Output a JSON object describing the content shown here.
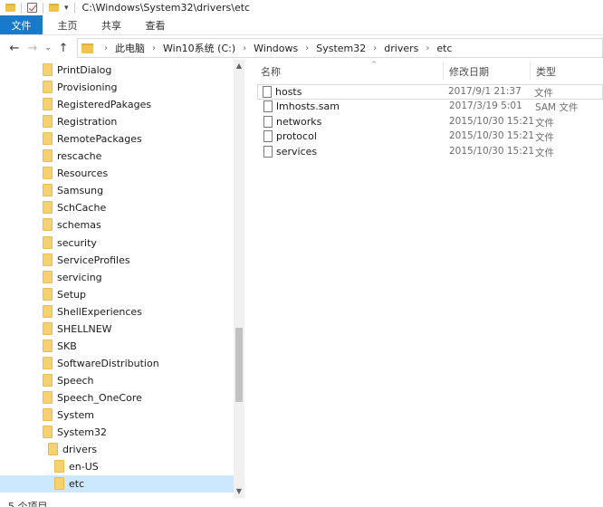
{
  "titlebar": {
    "path": "C:\\Windows\\System32\\drivers\\etc"
  },
  "ribbon": {
    "tabs": [
      "文件",
      "主页",
      "共享",
      "查看"
    ]
  },
  "nav": {
    "back": "←",
    "forward": "→",
    "recent": "⌄",
    "up": "↑"
  },
  "address": {
    "crumbs": [
      "此电脑",
      "Win10系统 (C:)",
      "Windows",
      "System32",
      "drivers",
      "etc"
    ],
    "separator": "›"
  },
  "tree": {
    "items": [
      {
        "label": "PrintDialog",
        "level": 0
      },
      {
        "label": "Provisioning",
        "level": 0
      },
      {
        "label": "RegisteredPakages",
        "level": 0
      },
      {
        "label": "Registration",
        "level": 0
      },
      {
        "label": "RemotePackages",
        "level": 0
      },
      {
        "label": "rescache",
        "level": 0
      },
      {
        "label": "Resources",
        "level": 0
      },
      {
        "label": "Samsung",
        "level": 0
      },
      {
        "label": "SchCache",
        "level": 0
      },
      {
        "label": "schemas",
        "level": 0
      },
      {
        "label": "security",
        "level": 0
      },
      {
        "label": "ServiceProfiles",
        "level": 0
      },
      {
        "label": "servicing",
        "level": 0
      },
      {
        "label": "Setup",
        "level": 0
      },
      {
        "label": "ShellExperiences",
        "level": 0
      },
      {
        "label": "SHELLNEW",
        "level": 0
      },
      {
        "label": "SKB",
        "level": 0
      },
      {
        "label": "SoftwareDistribution",
        "level": 0
      },
      {
        "label": "Speech",
        "level": 0
      },
      {
        "label": "Speech_OneCore",
        "level": 0
      },
      {
        "label": "System",
        "level": 0
      },
      {
        "label": "System32",
        "level": 0
      },
      {
        "label": "drivers",
        "level": 1
      },
      {
        "label": "en-US",
        "level": 2
      },
      {
        "label": "etc",
        "level": 2,
        "selected": true
      }
    ]
  },
  "columns": {
    "name": "名称",
    "date": "修改日期",
    "type": "类型"
  },
  "files": [
    {
      "name": "hosts",
      "date": "2017/9/1 21:37",
      "type": "文件"
    },
    {
      "name": "lmhosts.sam",
      "date": "2017/3/19 5:01",
      "type": "SAM 文件"
    },
    {
      "name": "networks",
      "date": "2015/10/30 15:21",
      "type": "文件"
    },
    {
      "name": "protocol",
      "date": "2015/10/30 15:21",
      "type": "文件"
    },
    {
      "name": "services",
      "date": "2015/10/30 15:21",
      "type": "文件"
    }
  ],
  "status": {
    "count": "5 个项目"
  },
  "colors": {
    "accent": "#1979ca",
    "selection": "#cce8ff",
    "folder": "#f5d172"
  }
}
